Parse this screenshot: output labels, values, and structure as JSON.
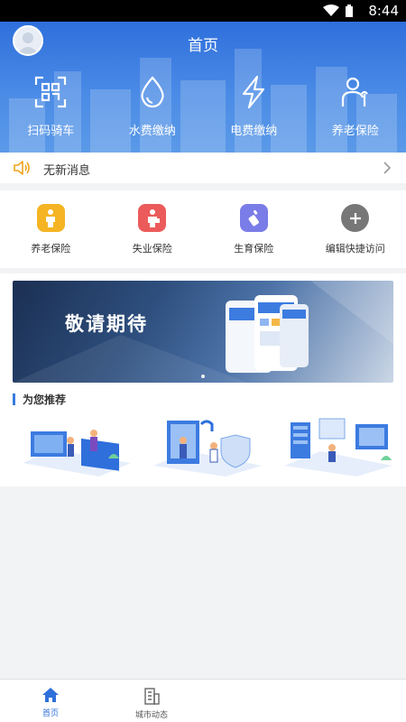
{
  "status_bar": {
    "time": "8:44"
  },
  "header": {
    "title": "首页"
  },
  "quick_actions": [
    {
      "label": "扫码骑车",
      "icon": "qr-scan-icon"
    },
    {
      "label": "水费缴纳",
      "icon": "water-drop-icon"
    },
    {
      "label": "电费缴纳",
      "icon": "lightning-icon"
    },
    {
      "label": "养老保险",
      "icon": "elderly-person-icon"
    }
  ],
  "notice": {
    "text": "无新消息"
  },
  "services": [
    {
      "label": "养老保险",
      "icon": "person-icon",
      "color": "#f5b423"
    },
    {
      "label": "失业保险",
      "icon": "worker-icon",
      "color": "#ec5b5b"
    },
    {
      "label": "生育保险",
      "icon": "baby-bottle-icon",
      "color": "#7a7ce8"
    },
    {
      "label": "编辑快捷访问",
      "icon": "plus-icon",
      "color": "#777777"
    }
  ],
  "banner": {
    "text": "敬请期待"
  },
  "recommend": {
    "title": "为您推荐"
  },
  "tabbar": {
    "items": [
      {
        "label": "首页",
        "icon": "home-icon",
        "active": true
      },
      {
        "label": "城市动态",
        "icon": "building-icon",
        "active": false
      }
    ]
  },
  "colors": {
    "primary": "#2f6fdc",
    "notice_icon": "#f2a31c"
  }
}
